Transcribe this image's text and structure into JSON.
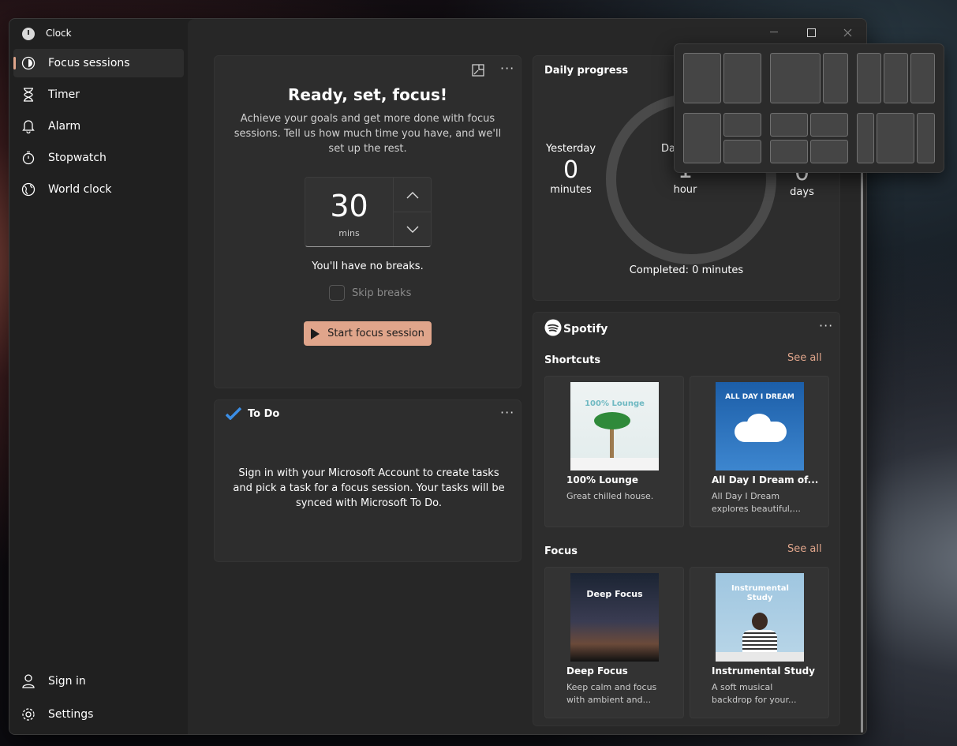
{
  "window": {
    "title": "Clock"
  },
  "sidebar": {
    "items": [
      {
        "label": "Focus sessions",
        "icon": "focus-icon",
        "active": true
      },
      {
        "label": "Timer",
        "icon": "hourglass-icon"
      },
      {
        "label": "Alarm",
        "icon": "bell-icon"
      },
      {
        "label": "Stopwatch",
        "icon": "stopwatch-icon"
      },
      {
        "label": "World clock",
        "icon": "globe-icon"
      }
    ],
    "bottom": [
      {
        "label": "Sign in",
        "icon": "person-icon"
      },
      {
        "label": "Settings",
        "icon": "gear-icon"
      }
    ]
  },
  "focus": {
    "title": "Ready, set, focus!",
    "description": "Achieve your goals and get more done with focus sessions. Tell us how much time you have, and we'll set up the rest.",
    "minutes": "30",
    "unit": "mins",
    "breaks_text": "You'll have no breaks.",
    "skip_breaks": "Skip breaks",
    "start_label": "Start focus session"
  },
  "todo": {
    "title": "To Do",
    "message": "Sign in with your Microsoft Account to create tasks and pick a task for a focus session. Your tasks will be synced with Microsoft To Do."
  },
  "daily": {
    "title": "Daily progress",
    "yesterday": {
      "label": "Yesterday",
      "value": "0",
      "unit": "minutes"
    },
    "goal": {
      "label": "Da",
      "value": "1",
      "unit": "hour"
    },
    "streak": {
      "value": "0",
      "unit": "days"
    },
    "completed": "Completed: 0 minutes"
  },
  "spotify": {
    "brand": "Spotify",
    "shortcuts_title": "Shortcuts",
    "focus_title": "Focus",
    "see_all": "See all",
    "shortcuts": [
      {
        "name": "100% Lounge",
        "desc": "Great chilled house.",
        "art_text": "100% Lounge"
      },
      {
        "name": "All Day I Dream of...",
        "desc": "All Day I Dream explores beautiful,...",
        "art_text": "ALL DAY I DREAM"
      }
    ],
    "focus": [
      {
        "name": "Deep Focus",
        "desc": "Keep calm and focus with ambient and...",
        "art_text": "Deep Focus"
      },
      {
        "name": "Instrumental Study",
        "desc": "A soft musical backdrop for your...",
        "art_text": "Instrumental Study"
      }
    ]
  },
  "colors": {
    "accent": "#e0a58b",
    "background": "#202020",
    "card": "#2d2d2d"
  }
}
